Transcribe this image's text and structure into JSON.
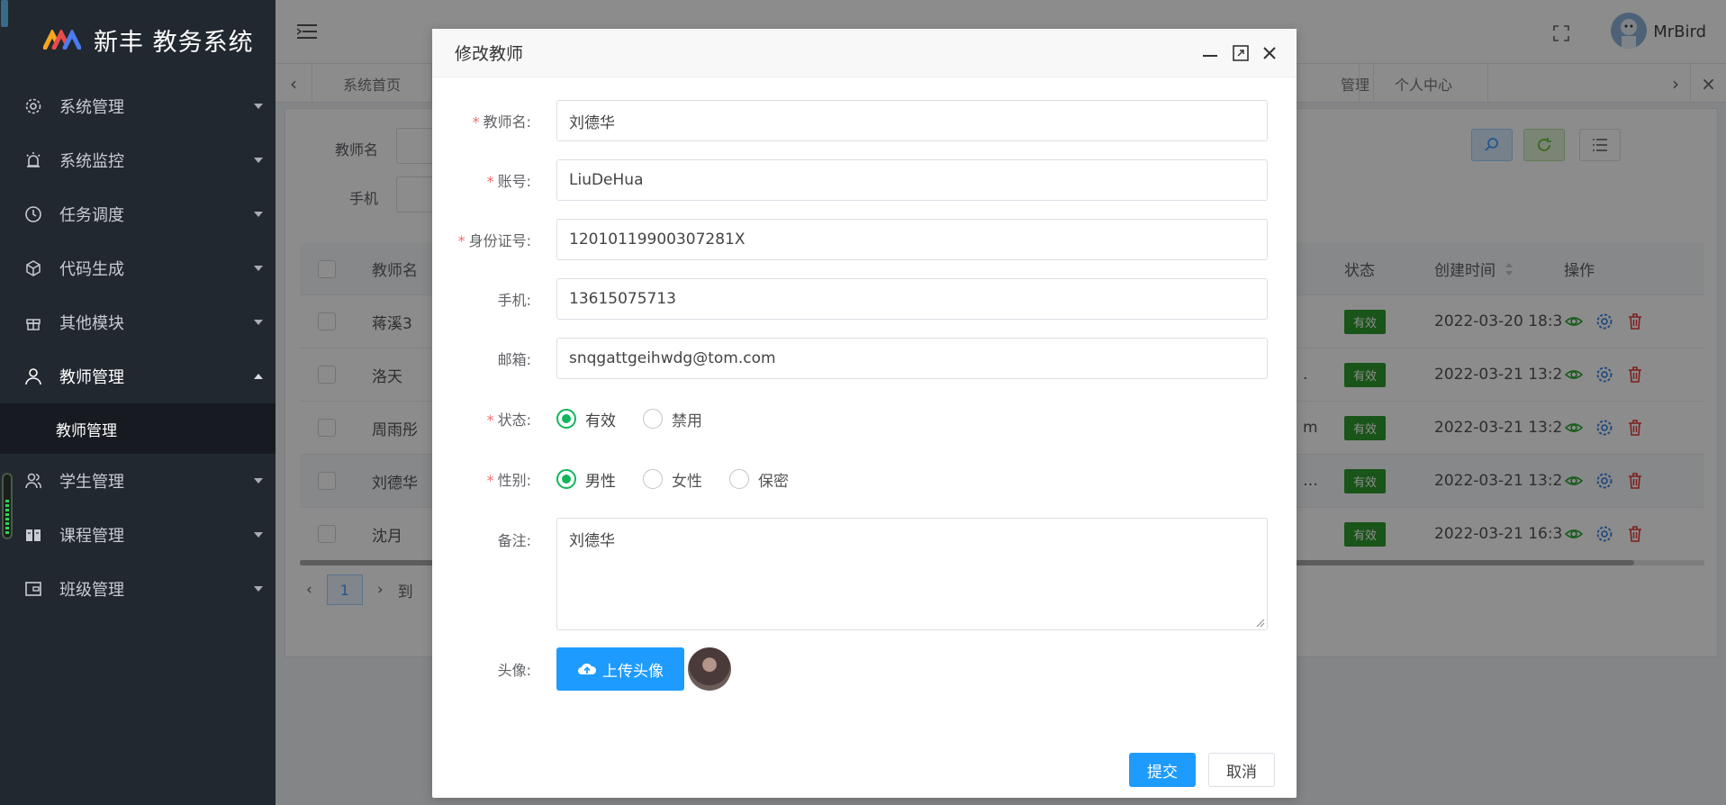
{
  "app": {
    "title": "新丰 教务系统"
  },
  "sidebar": {
    "items": [
      {
        "label": "系统管理",
        "icon": "gear-icon"
      },
      {
        "label": "系统监控",
        "icon": "alarm-icon"
      },
      {
        "label": "任务调度",
        "icon": "clock-icon"
      },
      {
        "label": "代码生成",
        "icon": "cube-icon"
      },
      {
        "label": "其他模块",
        "icon": "gift-icon"
      },
      {
        "label": "教师管理",
        "icon": "user-icon"
      },
      {
        "label": "学生管理",
        "icon": "users-icon"
      },
      {
        "label": "课程管理",
        "icon": "book-icon"
      },
      {
        "label": "班级管理",
        "icon": "wallet-icon"
      }
    ],
    "active_sub": "教师管理"
  },
  "header": {
    "username": "MrBird"
  },
  "tabs": {
    "items": [
      "系统首页",
      "管理",
      "个人中心"
    ]
  },
  "filters": {
    "teacher_name_label": "教师名",
    "phone_label": "手机"
  },
  "table": {
    "headers": {
      "name": "教师名",
      "status": "状态",
      "created": "创建时间",
      "ops": "操作"
    },
    "rows": [
      {
        "name": "蒋溪3",
        "extra": "",
        "status": "有效",
        "created": "2022-03-20 18:3"
      },
      {
        "name": "洛天",
        "extra": ".",
        "status": "有效",
        "created": "2022-03-21 13:2"
      },
      {
        "name": "周雨彤",
        "extra": "m",
        "status": "有效",
        "created": "2022-03-21 13:2"
      },
      {
        "name": "刘德华",
        "extra": "…",
        "status": "有效",
        "created": "2022-03-21 13:2"
      },
      {
        "name": "沈月",
        "extra": "",
        "status": "有效",
        "created": "2022-03-21 16:3"
      }
    ]
  },
  "pagination": {
    "current": "1",
    "goto_fragment": "到"
  },
  "modal": {
    "title": "修改教师",
    "fields": {
      "teacher_name": {
        "label": "教师名:",
        "value": "刘德华"
      },
      "account": {
        "label": "账号:",
        "value": "LiuDeHua"
      },
      "id_card": {
        "label": "身份证号:",
        "value": "12010119900307281X"
      },
      "phone": {
        "label": "手机:",
        "value": "13615075713"
      },
      "email": {
        "label": "邮箱:",
        "value": "snqgattgeihwdg@tom.com"
      },
      "status": {
        "label": "状态:",
        "options": [
          "有效",
          "禁用"
        ],
        "selected": "有效"
      },
      "gender": {
        "label": "性别:",
        "options": [
          "男性",
          "女性",
          "保密"
        ],
        "selected": "男性"
      },
      "remark": {
        "label": "备注:",
        "value": "刘德华"
      },
      "avatar": {
        "label": "头像:",
        "upload_label": "上传头像"
      }
    },
    "submit_label": "提交",
    "cancel_label": "取消"
  },
  "colors": {
    "primary": "#1e9bff",
    "success": "#2e9a2e",
    "radio": "#13b55b",
    "sidebar": "#222830"
  }
}
